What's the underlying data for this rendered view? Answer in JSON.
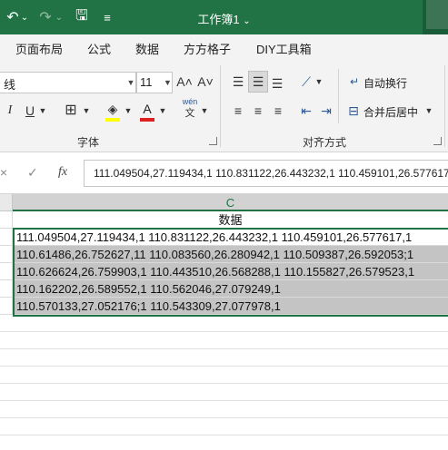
{
  "titlebar": {
    "title": "工作簿1",
    "title_arrow": "⌄",
    "undo_icon": "↶",
    "redo_icon": "↷",
    "dropdown_icon": "⌄",
    "save_icon": "🖫",
    "customize_icon": "≡"
  },
  "menu": {
    "items": [
      "页面布局",
      "公式",
      "数据",
      "方方格子",
      "DIY工具箱"
    ]
  },
  "ribbon": {
    "font_name": "线",
    "font_size": "11",
    "grow_font": "A˄",
    "shrink_font": "A˅",
    "italic": "I",
    "underline": "U",
    "border_icon": "⊞",
    "fill_icon": "◈",
    "font_color_label": "A",
    "phonetic_top": "wén",
    "phonetic_bottom": "文",
    "font_group_label": "字体",
    "align_group_label": "对齐方式",
    "wrap_text": "自动换行",
    "merge_center": "合并后居中",
    "fill_color": "#ffff00",
    "font_color": "#e02020"
  },
  "formula_bar": {
    "cancel_icon": "×",
    "enter_icon": "✓",
    "fx_label": "fx",
    "content": "111.049504,27.119434,1 110.831122,26.443232,1 110.459101,26.577617,1"
  },
  "sheet": {
    "column_letter": "C",
    "header_value": "数据",
    "rows": [
      "111.049504,27.119434,1 110.831122,26.443232,1 110.459101,26.577617,1",
      "110.61486,26.752627,11 110.083560,26.280942,1 110.509387,26.592053;1",
      "110.626624,26.759903,1 110.443510,26.568288,1 110.155827,26.579523,1",
      "110.162202,26.589552,1 110.562046,27.079249,1",
      "110.570133,27.052176;1 110.543309,27.077978,1"
    ],
    "accent_color": "#217346"
  }
}
